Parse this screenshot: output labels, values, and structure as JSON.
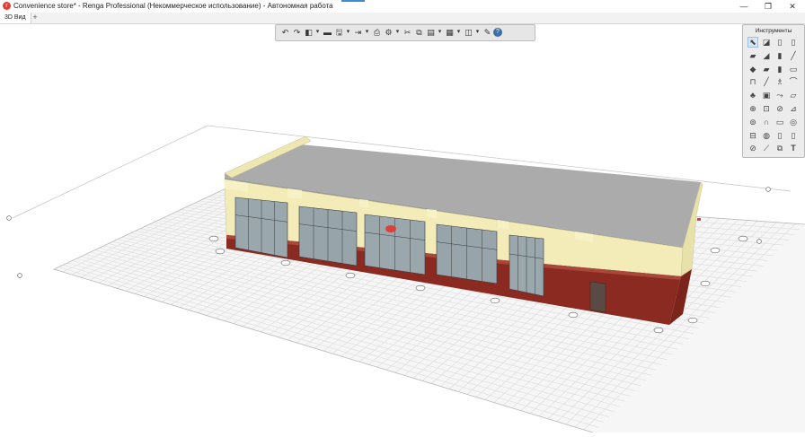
{
  "window": {
    "title": "Convenience store* - Renga Professional (Некоммерческое использование) - Автономная работа",
    "controls": [
      "—",
      "❐",
      "✕"
    ]
  },
  "tabs": [
    {
      "label": "3D Вид"
    }
  ],
  "toolbar": {
    "buttons": [
      "undo-icon",
      "redo-icon",
      "view-cube-icon",
      "dropdown-icon",
      "layers-icon",
      "save-icon",
      "dropdown-icon",
      "export-icon",
      "dropdown-icon",
      "print-icon",
      "settings-gear-icon",
      "dropdown-icon",
      "cut-icon",
      "copy-icon",
      "paste-icon",
      "dropdown-icon",
      "select-group-icon",
      "dropdown-icon",
      "layout-icon",
      "dropdown-icon",
      "wrench-icon",
      "help-icon"
    ]
  },
  "panel": {
    "title": "Инструменты",
    "tools": [
      "select-arrow-icon",
      "wall-tool-icon",
      "door-tool-icon",
      "window-tool-icon",
      "floor-tool-icon",
      "roof-tool-icon",
      "column-tool-icon",
      "beam-tool-icon",
      "slab-tool-icon",
      "stair-tool-icon",
      "opening-tool-icon",
      "ramp-tool-icon",
      "railing-tool-icon",
      "line-tool-icon",
      "text-style-icon",
      "pipe-tool-icon",
      "equipment-tool-icon",
      "cabinet-tool-icon",
      "route-tool-icon",
      "duct-tool-icon",
      "accessory-tool-icon",
      "fixture-tool-icon",
      "valve-tool-icon",
      "fitting-tool-icon",
      "group-tool-icon",
      "cycle-tool-icon",
      "room-tool-icon",
      "element-tool-icon",
      "assembly-tool-icon",
      "point-tool-icon",
      "dimension-tool-icon",
      "section-tool-icon",
      "axis-tool-icon",
      "level-tool-icon",
      "3d-text-icon",
      "text-tool-icon"
    ],
    "text_tool_glyph": "T"
  },
  "colors": {
    "wall_cream": "#f3ecb9",
    "brick_red": "#8b2a20",
    "roof_grey": "#ababab",
    "glazing": "#9aa8ad",
    "grid_line": "#dcdcdc",
    "accent_blue": "#3c8bd6"
  }
}
